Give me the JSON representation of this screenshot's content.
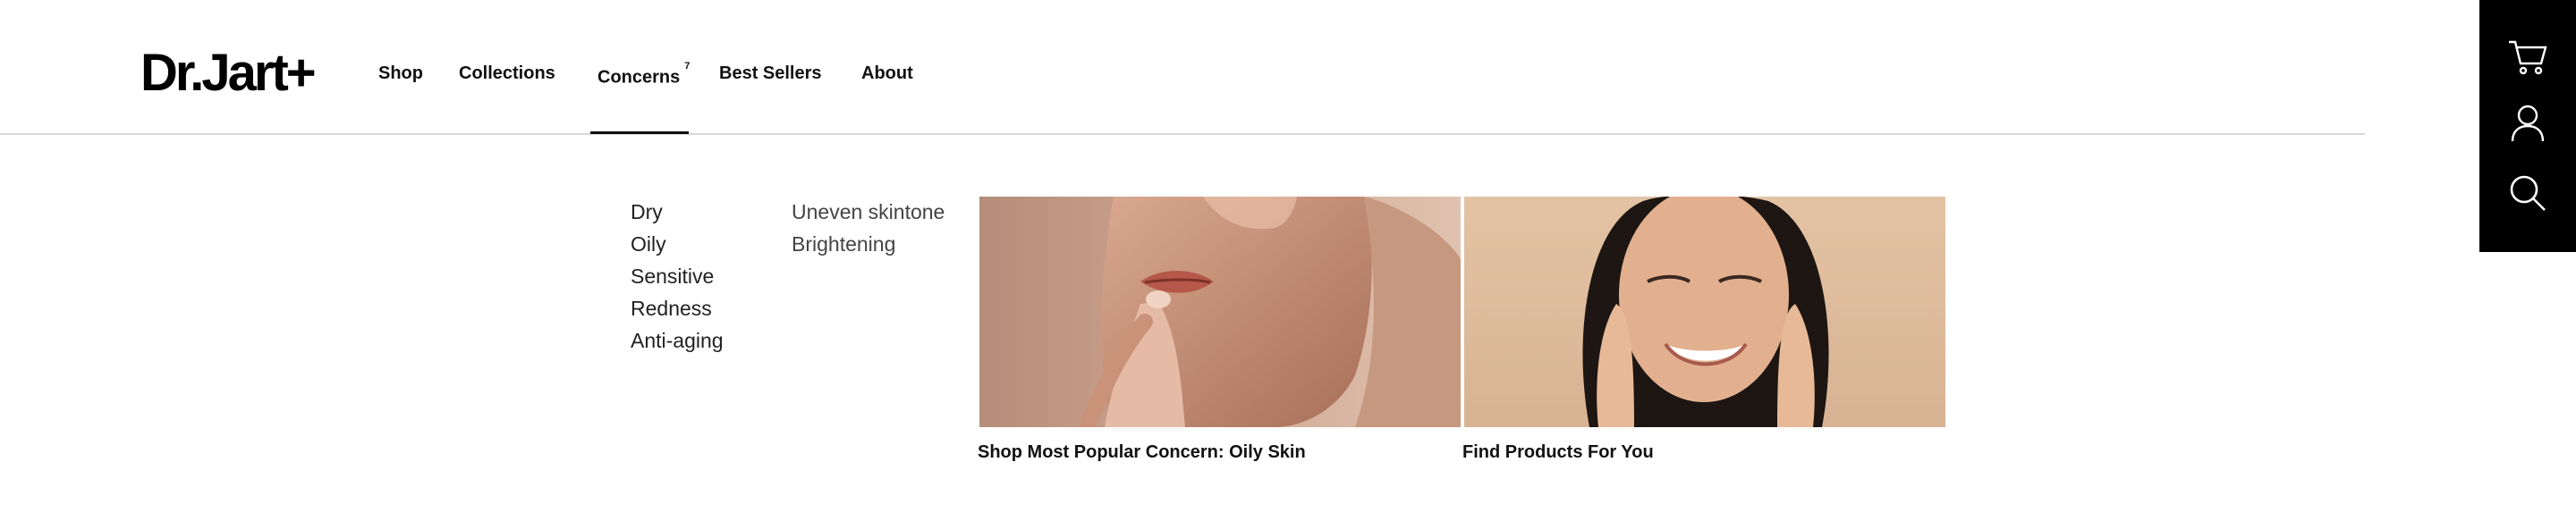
{
  "brand": {
    "logo_text": "Dr.Jart+"
  },
  "nav": {
    "items": [
      {
        "label": "Shop"
      },
      {
        "label": "Collections"
      },
      {
        "label": "Concerns",
        "badge": "7"
      },
      {
        "label": "Best Sellers"
      },
      {
        "label": "About"
      }
    ],
    "active": "Concerns"
  },
  "side_panel": {
    "icons": [
      "cart-icon",
      "account-icon",
      "search-icon"
    ]
  },
  "mega_menu": {
    "column1": [
      "Dry",
      "Oily",
      "Sensitive",
      "Redness",
      "Anti-aging"
    ],
    "column2": [
      "Uneven skintone",
      "Brightening"
    ],
    "promos": [
      {
        "caption": "Shop Most Popular Concern: Oily Skin",
        "image": "woman-touching-lips-photo"
      },
      {
        "caption": "Find Products For You",
        "image": "smiling-woman-hands-on-cheeks-photo"
      }
    ]
  },
  "colors": {
    "accent": "#000000",
    "divider": "#d9d9d9",
    "photo1_bg": "#c7a28c",
    "photo2_bg": "#e2c1a0"
  }
}
